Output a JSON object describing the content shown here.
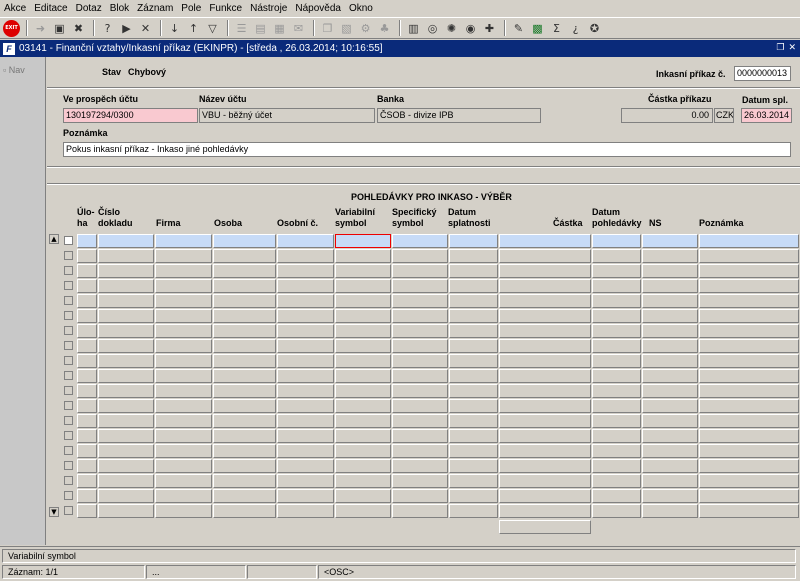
{
  "menu": [
    "Akce",
    "Editace",
    "Dotaz",
    "Blok",
    "Záznam",
    "Pole",
    "Funkce",
    "Nástroje",
    "Nápověda",
    "Okno"
  ],
  "toolbar": {
    "exit_label": "EXIT",
    "icons": [
      "exit-icon",
      "print-icon",
      "save-icon",
      "delete-record-icon",
      "query-icon",
      "execute-query-icon",
      "cancel-query-icon",
      "sort-asc-icon",
      "sort-desc-icon",
      "filter-icon",
      "list-icon",
      "report-icon",
      "calendar-icon",
      "mail-icon",
      "copy-icon",
      "paste-icon",
      "settings-icon",
      "tree-icon",
      "calculator-icon",
      "web-icon",
      "globe-icon",
      "help-topics-icon",
      "attachment-icon",
      "edit-icon",
      "excel-icon",
      "sigma-icon",
      "help-icon",
      "info-icon"
    ]
  },
  "window": {
    "title": "03141 - Finanční vztahy/Inkasní příkaz (EKINPR) - [středa , 26.03.2014; 10:16:55]",
    "logo": "F"
  },
  "nav_label": "Nav",
  "header": {
    "stav_label": "Stav",
    "stav_value": "Chybový",
    "inkasni_label": "Inkasní příkaz č.",
    "inkasni_value": "0000000013",
    "ve_prospech_label": "Ve prospěch účtu",
    "ve_prospech_value": "130197294/0300",
    "nazev_uctu_label": "Název účtu",
    "nazev_uctu_value": "VBU - běžný účet",
    "banka_label": "Banka",
    "banka_value": "ČSOB - divize IPB",
    "castka_label": "Částka příkazu",
    "castka_value": "0.00",
    "mena_value": "CZK",
    "datum_spl_label": "Datum spl.",
    "datum_spl_value": "26.03.2014",
    "poznamka_label": "Poznámka",
    "poznamka_value": "Pokus inkasní příkaz - Inkaso jiné pohledávky"
  },
  "section": {
    "title": "POHLEDÁVKY PRO INKASO - VÝBĚR",
    "col_uloha_1": "Úlo-",
    "col_uloha_2": "ha",
    "col_cislo_1": "Číslo",
    "col_cislo_2": "dokladu",
    "col_firma": "Firma",
    "col_osoba": "Osoba",
    "col_osobni": "Osobní č.",
    "col_vs_1": "Variabilní",
    "col_vs_2": "symbol",
    "col_ss_1": "Specifický",
    "col_ss_2": "symbol",
    "col_ds_1": "Datum",
    "col_ds_2": "splatnosti",
    "col_castka": "Částka",
    "col_dp_1": "Datum",
    "col_dp_2": "pohledávky",
    "col_ns": "NS",
    "col_poznamka": "Poznámka"
  },
  "status": {
    "field_hint": "Variabilní symbol",
    "record": "Záznam: 1/1",
    "dots": "...",
    "osc": "<OSC>"
  }
}
